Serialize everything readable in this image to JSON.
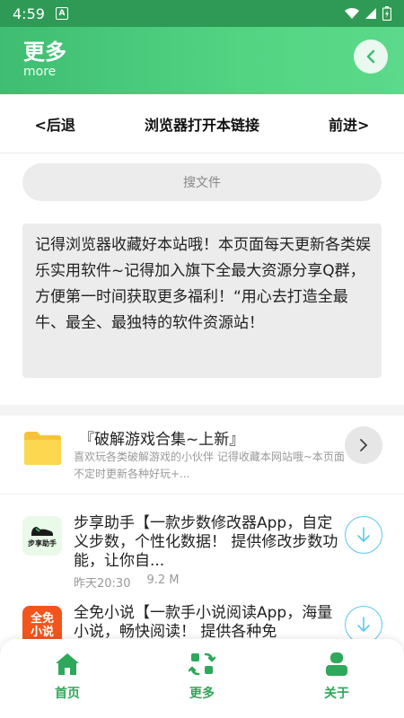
{
  "status_bar": {
    "time": "4:59",
    "badge": "A"
  },
  "header": {
    "title": "更多",
    "subtitle": "more"
  },
  "navbar": {
    "back": "<后退",
    "open_browser": "浏览器打开本链接",
    "forward": "前进>"
  },
  "search": {
    "placeholder": "搜文件"
  },
  "notice": {
    "text": "记得浏览器收藏好本站哦！本页面每天更新各类娱乐实用软件~记得加入旗下全最大资源分享Q群，方便第一时间获取更多福利！“用心去打造全最牛、最全、最独特的软件资源站！"
  },
  "folder": {
    "title": "『破解游戏合集~上新』",
    "desc": "喜欢玩各类破解游戏的小伙伴 记得收藏本网站哦~本页面不定时更新各种好玩+..."
  },
  "apps": [
    {
      "icon_label": "步享助手",
      "text": "步享助手【一款步数修改器App，自定义步数，个性化数据！ 提供修改步数功能，让你自...",
      "time": "昨天20:30",
      "size": "9.2 M"
    },
    {
      "icon_label_top": "全免",
      "icon_label_bottom": "小说",
      "text": "全免小说【一款手小说阅读App，海量小说，畅快阅读！ 提供各种免"
    }
  ],
  "bottom_nav": {
    "home": "首页",
    "more": "更多",
    "about": "关于"
  },
  "colors": {
    "accent": "#2ea85a",
    "header_start": "#3fbd72",
    "header_end": "#5cd98a",
    "download": "#58c9f0"
  }
}
